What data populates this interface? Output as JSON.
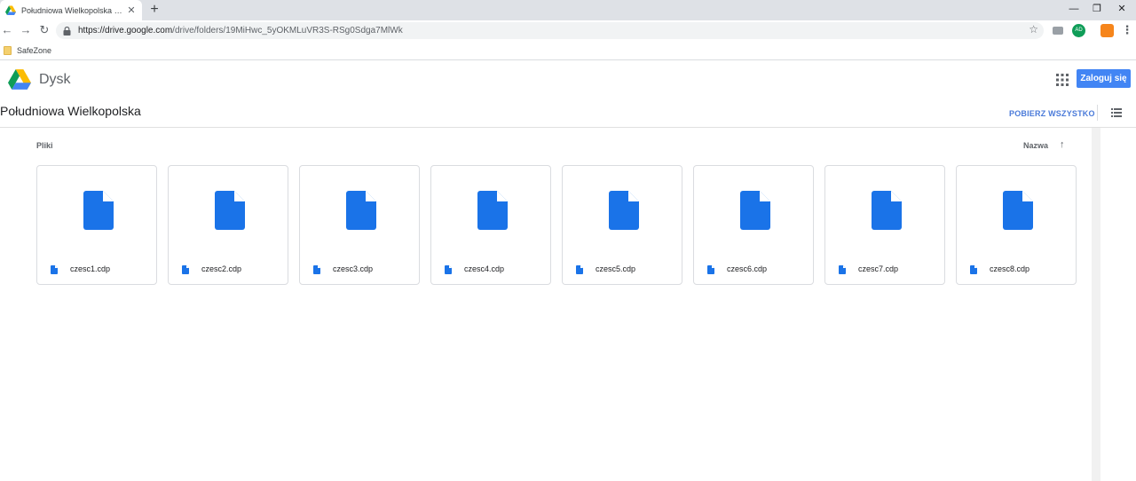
{
  "browser": {
    "tab_title": "Południowa Wielkopolska – Dysk Google",
    "tab_close": "✕",
    "new_tab": "+",
    "window": {
      "minimize": "—",
      "restore": "❐",
      "close": "✕"
    },
    "nav": {
      "back": "←",
      "forward": "→",
      "reload": "↻"
    },
    "url_host": "https://drive.google.com",
    "url_path": "/drive/folders/19MiHwc_5yOKMLuVR3S-RSg0Sdga7MlWk",
    "star": "☆",
    "extensions": [
      {
        "label": "",
        "color": "#9aa0a6"
      },
      {
        "label": "AD",
        "color": "#0f9d58"
      },
      {
        "label": "",
        "color": "#f6851b"
      }
    ],
    "menu": "⋮",
    "bookmarks": [
      {
        "label": "SafeZone"
      }
    ]
  },
  "drive": {
    "brand": "Dysk",
    "login_button": "Zaloguj się",
    "folder_title": "Południowa Wielkopolska",
    "download_all": "POBIERZ WSZYSTKO",
    "section_label": "Pliki",
    "sort_label": "Nazwa",
    "sort_arrow": "↑",
    "accent_color": "#4285f4",
    "file_icon_color": "#1a73e8",
    "files": [
      {
        "name": "czesc1.cdp"
      },
      {
        "name": "czesc2.cdp"
      },
      {
        "name": "czesc3.cdp"
      },
      {
        "name": "czesc4.cdp"
      },
      {
        "name": "czesc5.cdp"
      },
      {
        "name": "czesc6.cdp"
      },
      {
        "name": "czesc7.cdp"
      },
      {
        "name": "czesc8.cdp"
      }
    ]
  }
}
